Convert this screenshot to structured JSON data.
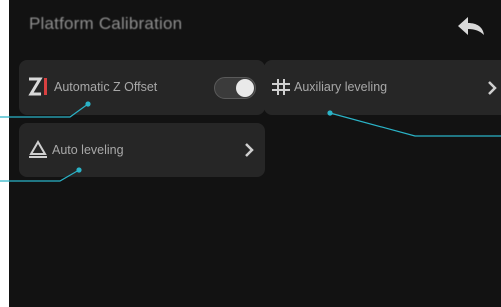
{
  "header": {
    "title": "Platform Calibration",
    "back_icon": "back-arrow-icon"
  },
  "tiles": {
    "auto_z": {
      "label": "Automatic Z Offset",
      "icon": "z-offset-icon",
      "toggle_on": true
    },
    "aux_leveling": {
      "label": "Auxiliary leveling",
      "icon": "auxiliary-leveling-icon"
    },
    "auto_leveling": {
      "label": "Auto leveling",
      "icon": "auto-leveling-icon"
    }
  },
  "colors": {
    "screen_bg": "#121212",
    "tile_bg": "#262626",
    "text": "#a8a8a8",
    "callout": "#2ab3c7",
    "z_icon_accent": "#d84040"
  }
}
